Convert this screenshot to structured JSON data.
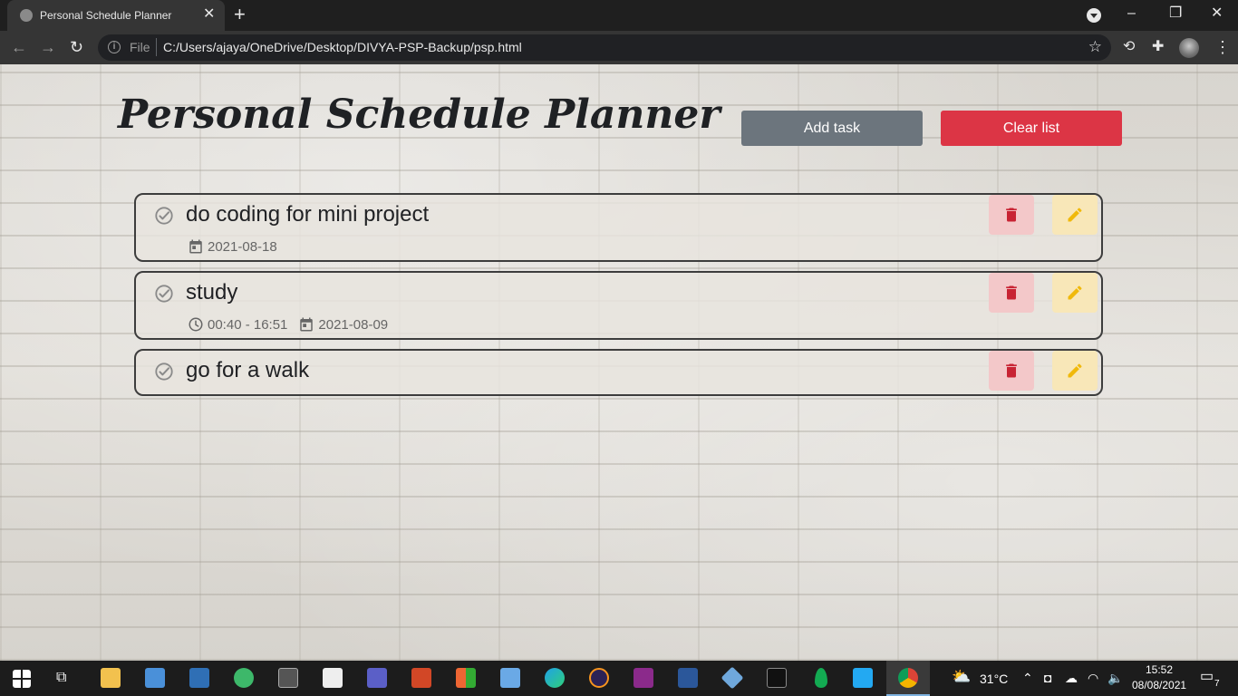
{
  "browser": {
    "tab_title": "Personal Schedule Planner",
    "tab_close": "✕",
    "new_tab": "+",
    "url_scheme": "File",
    "url": "C:/Users/ajaya/OneDrive/Desktop/DIVYA-PSP-Backup/psp.html",
    "window_controls": {
      "minimize": "–",
      "restore": "❐",
      "close": "✕"
    },
    "nav": {
      "back": "←",
      "forward": "→",
      "reload": "↻"
    }
  },
  "page": {
    "title": "Personal Schedule Planner",
    "add_task_label": "Add task",
    "clear_list_label": "Clear list",
    "colors": {
      "add": "#6c757d",
      "clear": "#dc3545",
      "delete_icon": "#c82333",
      "edit_icon": "#f0b90b"
    }
  },
  "tasks": [
    {
      "title": "do coding for mini project",
      "time": "",
      "date": "2021-08-18"
    },
    {
      "title": "study",
      "time": "00:40 - 16:51",
      "date": "2021-08-09"
    },
    {
      "title": "go for a walk",
      "time": "",
      "date": ""
    }
  ],
  "taskbar": {
    "weather": "31°C",
    "time": "15:52",
    "date": "08/08/2021",
    "notifications": "7"
  }
}
